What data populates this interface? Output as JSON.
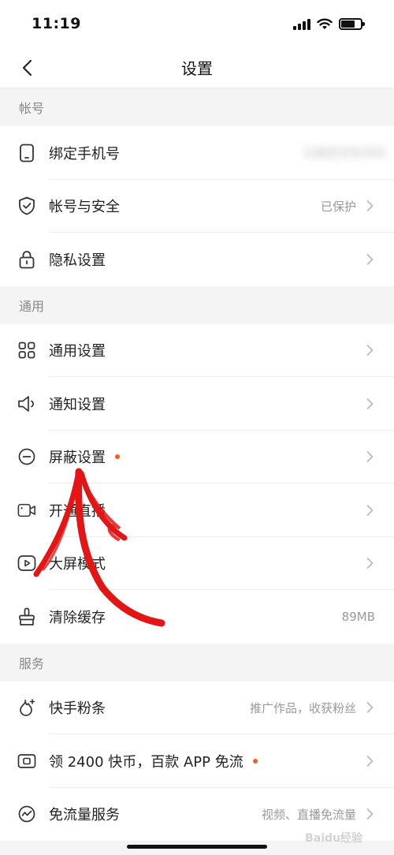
{
  "status_bar": {
    "time": "11:19"
  },
  "nav": {
    "title": "设置"
  },
  "sections": {
    "account": {
      "header": "帐号",
      "rows": [
        {
          "label": "绑定手机号",
          "value": "已绑定手机号码"
        },
        {
          "label": "帐号与安全",
          "value": "已保护"
        },
        {
          "label": "隐私设置",
          "value": ""
        }
      ]
    },
    "general": {
      "header": "通用",
      "rows": [
        {
          "label": "通用设置",
          "value": ""
        },
        {
          "label": "通知设置",
          "value": ""
        },
        {
          "label": "屏蔽设置",
          "value": ""
        },
        {
          "label": "开通直播",
          "value": ""
        },
        {
          "label": "大屏模式",
          "value": ""
        },
        {
          "label": "清除缓存",
          "value": "89MB"
        }
      ]
    },
    "service": {
      "header": "服务",
      "rows": [
        {
          "label": "快手粉条",
          "value": "推广作品，收获粉丝"
        },
        {
          "label": "领 2400 快币，百款 APP 免流",
          "value": ""
        },
        {
          "label": "免流量服务",
          "value": "视频、直播免流量"
        }
      ]
    }
  },
  "watermark": "Baidu经验",
  "colors": {
    "dot": "#fe5b1a",
    "annotation_arrow": "#e31515"
  }
}
